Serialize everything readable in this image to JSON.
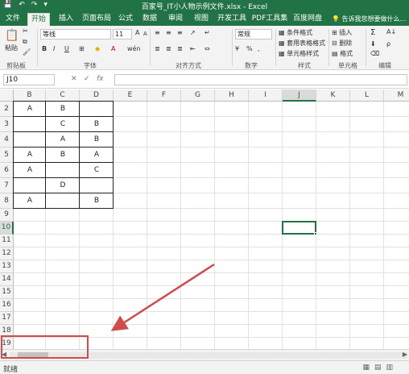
{
  "window": {
    "title": "百家号_IT小人物示例文件.xlsx - Excel",
    "quick_access": [
      "💾",
      "↶",
      "↷",
      "▾"
    ]
  },
  "tabs": [
    "文件",
    "开始",
    "插入",
    "页面布局",
    "公式",
    "数据",
    "审阅",
    "视图",
    "开发工具",
    "PDF工具集",
    "百度网盘"
  ],
  "active_tab": "开始",
  "tell_me": "告诉我您想要做什么...",
  "ribbon": {
    "clipboard": {
      "label": "剪贴板",
      "paste": "粘贴"
    },
    "font": {
      "label": "字体",
      "name": "等线",
      "size": "11",
      "bold": "B",
      "italic": "I",
      "underline": "U",
      "grow": "A",
      "shrink": "A",
      "phonetic": "wén"
    },
    "alignment": {
      "label": "对齐方式"
    },
    "number": {
      "label": "数字",
      "format": "常规",
      "percent": "%",
      "comma": ",",
      "currency": "¥"
    },
    "styles": {
      "label": "样式",
      "cond": "条件格式",
      "table": "套用表格格式",
      "cell": "单元格样式"
    },
    "cells": {
      "label": "单元格",
      "insert": "插入",
      "delete": "删除",
      "format": "格式"
    },
    "editing": {
      "label": "编辑",
      "sum": "Σ",
      "sort": "A↓",
      "find": "ρ"
    }
  },
  "formula_bar": {
    "name_box": "J10",
    "cancel": "✕",
    "enter": "✓",
    "fx": "fx",
    "value": ""
  },
  "sheet": {
    "columns": [
      "B",
      "C",
      "D",
      "E",
      "F",
      "G",
      "H",
      "I",
      "J",
      "K",
      "L",
      "M"
    ],
    "rows": [
      "2",
      "3",
      "4",
      "5",
      "6",
      "7",
      "8",
      "9",
      "10",
      "11",
      "12",
      "13",
      "14",
      "15",
      "16",
      "17",
      "18",
      "19"
    ],
    "selected_cell": "J10",
    "data": [
      {
        "row": "2",
        "B": "A",
        "C": "B",
        "D": ""
      },
      {
        "row": "3",
        "B": "",
        "C": "C",
        "D": "B"
      },
      {
        "row": "4",
        "B": "",
        "C": "A",
        "D": "B"
      },
      {
        "row": "5",
        "B": "A",
        "C": "B",
        "D": "A"
      },
      {
        "row": "6",
        "B": "A",
        "C": "",
        "D": "C"
      },
      {
        "row": "7",
        "B": "",
        "C": "D",
        "D": ""
      },
      {
        "row": "8",
        "B": "A",
        "C": "",
        "D": "B"
      }
    ]
  },
  "status": {
    "text": "就绪"
  },
  "colors": {
    "accent": "#217346",
    "annotation": "#d24b4b"
  }
}
